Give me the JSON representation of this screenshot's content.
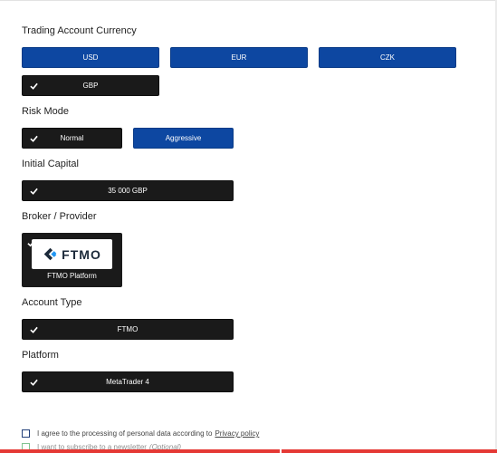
{
  "currency": {
    "label": "Trading Account Currency",
    "options": [
      "USD",
      "EUR",
      "CZK",
      "GBP"
    ],
    "selected": "GBP"
  },
  "risk": {
    "label": "Risk Mode",
    "options": [
      "Normal",
      "Aggressive"
    ],
    "selected": "Normal"
  },
  "capital": {
    "label": "Initial Capital",
    "value": "35 000 GBP"
  },
  "broker": {
    "label": "Broker / Provider",
    "logo_text": "FTMO",
    "name": "FTMO Platform"
  },
  "account_type": {
    "label": "Account Type",
    "value": "FTMO"
  },
  "platform": {
    "label": "Platform",
    "value": "MetaTrader 4"
  },
  "consent": {
    "privacy_text": "I agree to the processing of personal data according to",
    "privacy_link": "Privacy policy",
    "newsletter_text": "I want to subscribe to a newsletter",
    "newsletter_optional": "(Optional)"
  },
  "colors": {
    "selected_dark": "#1a1a1a",
    "option_blue": "#0d47a1",
    "accent_red": "#e53935"
  },
  "icons": {
    "check": "checkmark-icon",
    "logo": "ftmo-logo-icon"
  }
}
